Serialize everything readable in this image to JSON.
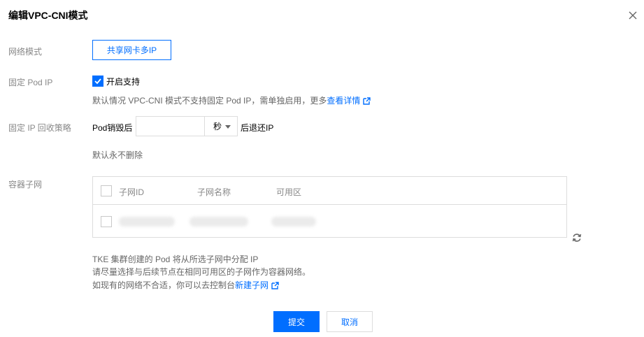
{
  "dialog": {
    "title": "编辑VPC-CNI模式",
    "close_icon": "close-icon"
  },
  "network_mode": {
    "label": "网络模式",
    "button_label": "共享网卡多IP"
  },
  "fixed_ip": {
    "label": "固定 Pod IP",
    "checked": true,
    "checkbox_label": "开启支持",
    "help_prefix": "默认情况 VPC-CNI 模式不支持固定 Pod IP，需单独启用，更多",
    "help_link": "查看详情",
    "link_icon": "external-link-icon"
  },
  "recycle": {
    "label": "固定 IP 回收策略",
    "prefix": "Pod销毁后",
    "input_value": "",
    "unit_selected": "秒",
    "suffix": "后退还IP",
    "help": "默认永不删除"
  },
  "subnet": {
    "label": "容器子网",
    "columns": [
      "子网ID",
      "子网名称",
      "可用区"
    ],
    "refresh_icon": "refresh-icon",
    "help_line1": "TKE 集群创建的 Pod 将从所选子网中分配 IP",
    "help_line2": "请尽量选择与后续节点在相同可用区的子网作为容器网络。",
    "help_line3_prefix": "如现有的网络不合适，你可以去控制台",
    "help_line3_link": "新建子网",
    "link_icon": "external-link-icon"
  },
  "actions": {
    "submit_label": "提交",
    "cancel_label": "取消"
  },
  "colors": {
    "primary": "#006eff",
    "label_gray": "#888888",
    "border": "#dddddd"
  }
}
